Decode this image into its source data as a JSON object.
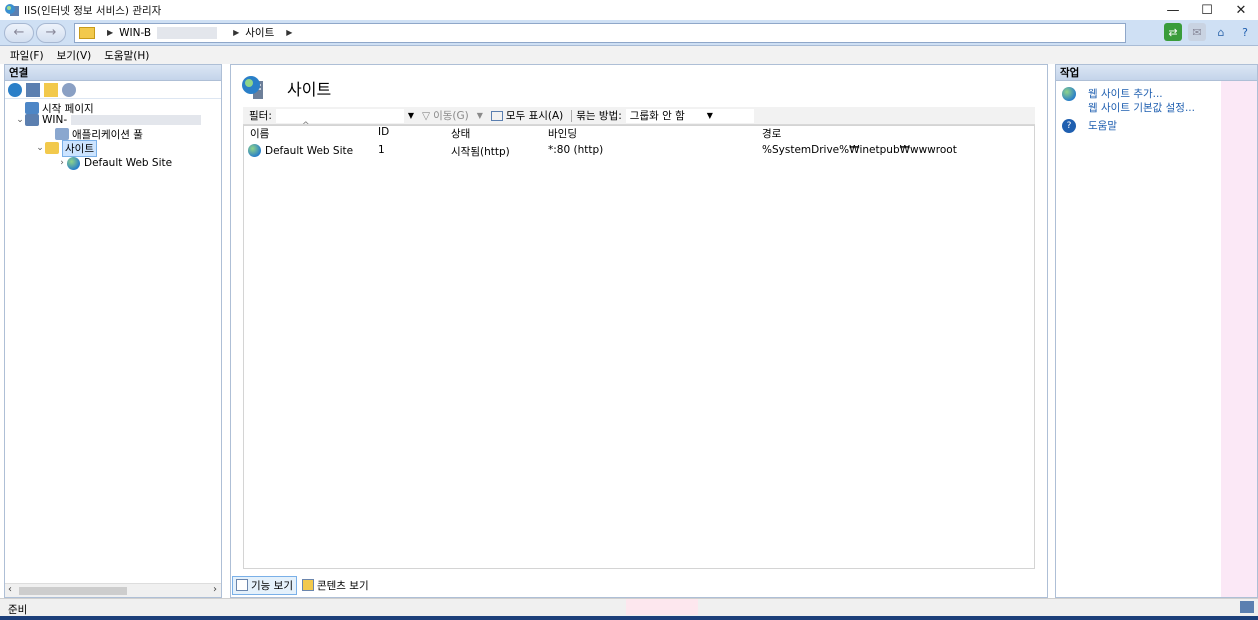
{
  "window": {
    "title": "IIS(인터넷 정보 서비스) 관리자",
    "minimize": "—",
    "maximize": "☐",
    "close": "✕"
  },
  "address": {
    "crumbs": [
      "WIN-B",
      "사이트"
    ]
  },
  "menu": {
    "items": [
      "파일(F)",
      "보기(V)",
      "도움말(H)"
    ]
  },
  "connections": {
    "header": "연결",
    "tree": [
      {
        "label": "시작 페이지"
      },
      {
        "label": "WIN-"
      },
      {
        "label": "애플리케이션 풀"
      },
      {
        "label": "사이트"
      },
      {
        "label": "Default Web Site"
      }
    ]
  },
  "center": {
    "title": "사이트",
    "filter": {
      "label": "필터:",
      "go": "이동(G)",
      "show_all": "모두 표시(A)",
      "group_label": "묶는 방법:",
      "group_value": "그룹화 안 함"
    },
    "columns": [
      "이름",
      "ID",
      "상태",
      "바인딩",
      "경로"
    ],
    "rows": [
      {
        "name": "Default Web Site",
        "id": "1",
        "status": "시작됨(http)",
        "binding": "*:80 (http)",
        "path": "%SystemDrive%₩inetpub₩wwwroot"
      }
    ],
    "tabs": {
      "features": "기능 보기",
      "content": "콘텐츠 보기"
    }
  },
  "actions": {
    "header": "작업",
    "items": [
      "웹 사이트 추가...",
      "웹 사이트 기본값 설정...",
      "도움말"
    ]
  },
  "status": {
    "text": "준비"
  }
}
